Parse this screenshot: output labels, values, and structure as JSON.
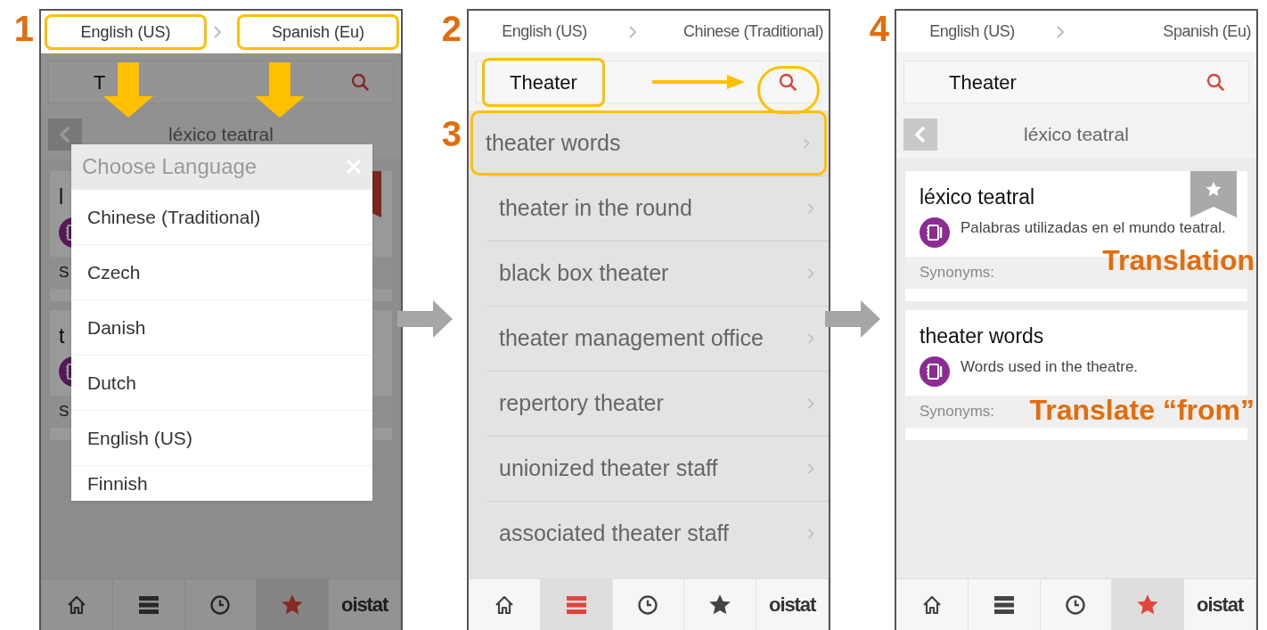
{
  "panels": [
    {
      "step_labels": [
        "1"
      ],
      "screen": {
        "languages": {
          "from": "English (US)",
          "to": "Spanish (Eu)",
          "highlighted": true
        },
        "search": {
          "value": "T",
          "highlighted": false
        },
        "header": "léxico teatral",
        "cards": [
          {
            "kind": "stub",
            "title": "l",
            "synonyms_label": "S",
            "bookmark": {
              "saved": true
            }
          },
          {
            "kind": "stub",
            "title": "t",
            "synonyms_label": "S"
          }
        ],
        "dialog": {
          "title": "Choose Language",
          "options": [
            "Chinese (Traditional)",
            "Czech",
            "Danish",
            "Dutch",
            "English (US)",
            "Finnish"
          ]
        },
        "tabs": [
          {
            "kind": "home",
            "selected": false
          },
          {
            "kind": "list",
            "selected": false
          },
          {
            "kind": "history",
            "selected": false
          },
          {
            "kind": "favorites",
            "selected": true
          },
          {
            "kind": "logo",
            "label": "oistat",
            "selected": false
          }
        ]
      }
    },
    {
      "step_labels": [
        "2",
        "3"
      ],
      "screen": {
        "languages": {
          "from": "English (US)",
          "to": "Chinese (Traditional)",
          "highlighted": false
        },
        "search": {
          "value": "Theater",
          "highlighted": true
        },
        "results": [
          {
            "label": "theater words",
            "highlighted": true
          },
          {
            "label": "theater in the round",
            "highlighted": false
          },
          {
            "label": "black box theater",
            "highlighted": false
          },
          {
            "label": "theater management office",
            "highlighted": false
          },
          {
            "label": "repertory theater",
            "highlighted": false
          },
          {
            "label": "unionized theater staff",
            "highlighted": false
          },
          {
            "label": "associated theater staff",
            "highlighted": false
          }
        ],
        "tabs": [
          {
            "kind": "home",
            "selected": false
          },
          {
            "kind": "list",
            "selected": true
          },
          {
            "kind": "history",
            "selected": false
          },
          {
            "kind": "favorites",
            "selected": false
          },
          {
            "kind": "logo",
            "label": "oistat",
            "selected": false
          }
        ]
      }
    },
    {
      "step_labels": [
        "4"
      ],
      "screen": {
        "languages": {
          "from": "English (US)",
          "to": "Spanish (Eu)",
          "highlighted": false
        },
        "search": {
          "value": "Theater",
          "highlighted": false
        },
        "header": "léxico teatral",
        "cards": [
          {
            "kind": "full",
            "title": "léxico teatral",
            "definition": "Palabras utilizadas en el mundo teatral.",
            "synonyms_label": "Synonyms:",
            "bookmark": {
              "saved": false
            },
            "note": "Translation"
          },
          {
            "kind": "full",
            "title": "theater words",
            "definition": "Words used in the theatre.",
            "synonyms_label": "Synonyms:",
            "note": "Translate “from”"
          }
        ],
        "tabs": [
          {
            "kind": "home",
            "selected": false
          },
          {
            "kind": "list",
            "selected": false
          },
          {
            "kind": "history",
            "selected": false
          },
          {
            "kind": "favorites",
            "selected": true
          },
          {
            "kind": "logo",
            "label": "oistat",
            "selected": false
          }
        ]
      }
    }
  ]
}
